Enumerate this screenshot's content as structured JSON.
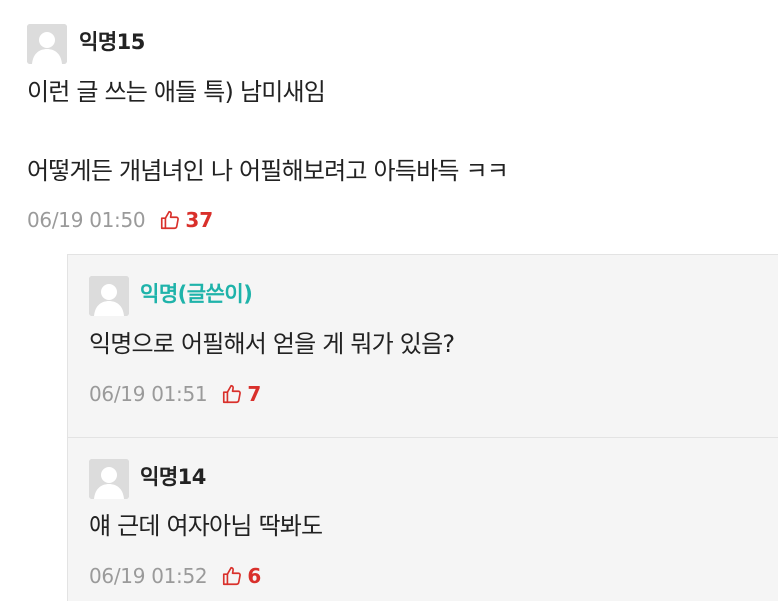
{
  "comments": [
    {
      "nickname": "익명15",
      "lines": [
        "이런 글 쓰는 애들 특) 남미새임",
        "어떻게든 개념녀인 나 어필해보려고 아득바득 ㅋㅋ"
      ],
      "time": "06/19 01:50",
      "likes": "37"
    }
  ],
  "replies": [
    {
      "nickname": "익명(글쓴이)",
      "is_author": true,
      "text": "익명으로 어필해서 얻을 게 뭐가 있음?",
      "time": "06/19 01:51",
      "likes": "7"
    },
    {
      "nickname": "익명14",
      "is_author": false,
      "text": "얘 근데 여자아님 딱봐도",
      "time": "06/19 01:52",
      "likes": "6"
    }
  ],
  "colors": {
    "author_accent": "#1fb3aa",
    "like_red": "#d9302b",
    "meta_gray": "#9a9a9a",
    "reply_bg": "#f5f5f5"
  },
  "icons": {
    "avatar": "default-avatar-icon",
    "like": "thumbs-up-icon"
  }
}
